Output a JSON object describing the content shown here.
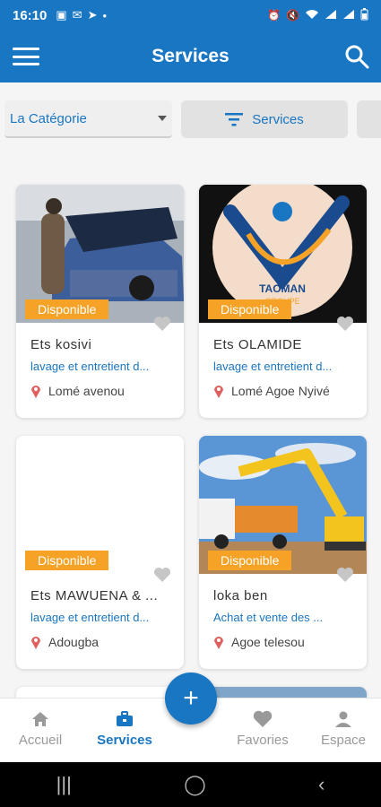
{
  "status_bar": {
    "time": "16:10"
  },
  "app_bar": {
    "title": "Services"
  },
  "filters": {
    "category_label": "La Catégorie",
    "services_label": "Services"
  },
  "cards": [
    {
      "badge": "Disponible",
      "title": "Ets kosivi",
      "category": "lavage et entretient d...",
      "location": "Lomé avenou"
    },
    {
      "badge": "Disponible",
      "title": "Ets OLAMIDE",
      "category": "lavage et entretient d...",
      "location": "Lomé Agoe Nyivé",
      "logo_text": "TAOMAN",
      "logo_sub": "GROUPE"
    },
    {
      "badge": "Disponible",
      "title": "Ets MAWUENA & ...",
      "category": "lavage et entretient d...",
      "location": "Adougba"
    },
    {
      "badge": "Disponible",
      "title": "loka ben",
      "category": "Achat et vente des ...",
      "location": "Agoe telesou"
    }
  ],
  "bottom_nav": {
    "items": [
      {
        "label": "Accueil",
        "icon": "home-icon"
      },
      {
        "label": "Services",
        "icon": "briefcase-icon"
      },
      {
        "label": "Favories",
        "icon": "heart-icon"
      },
      {
        "label": "Espace",
        "icon": "person-icon"
      }
    ],
    "fab": "+"
  },
  "colors": {
    "primary": "#1976c2",
    "badge": "#f5a227"
  }
}
